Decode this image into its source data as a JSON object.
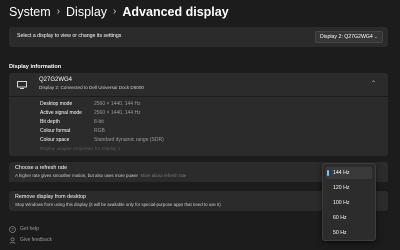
{
  "breadcrumb": {
    "items": [
      "System",
      "Display",
      "Advanced display"
    ]
  },
  "display_selector": {
    "prompt": "Select a display to view or change its settings",
    "selected": "Display 2: Q27G2WG4"
  },
  "display_information": {
    "heading": "Display information",
    "monitor_name": "Q27G2WG4",
    "monitor_connection": "Display 2: Connected to Dell Universal Dock D6000",
    "rows": [
      {
        "label": "Desktop mode",
        "value": "2560 × 1440, 144 Hz"
      },
      {
        "label": "Active signal mode",
        "value": "2560 × 1440, 144 Hz"
      },
      {
        "label": "Bit depth",
        "value": "8-bit"
      },
      {
        "label": "Colour format",
        "value": "RGB"
      },
      {
        "label": "Colour space",
        "value": "Standard dynamic range (SDR)"
      }
    ],
    "adapter_link": "Display adapter properties for Display 2"
  },
  "refresh_rate": {
    "title": "Choose a refresh rate",
    "description": "A higher rate gives smoother motion, but also uses more power",
    "more_link": "More about refresh rate",
    "options": [
      "144 Hz",
      "120 Hz",
      "100 Hz",
      "60 Hz",
      "50 Hz"
    ],
    "selected": "144 Hz"
  },
  "remove_display": {
    "title": "Remove display from desktop",
    "description": "Stop Windows from using this display (it will be available only for special-purpose apps that need to use it)"
  },
  "footer": {
    "get_help": "Get help",
    "give_feedback": "Give feedback"
  },
  "colors": {
    "background": "#1c1c1c",
    "card": "#2b2b2b",
    "accent": "#60cdff"
  }
}
